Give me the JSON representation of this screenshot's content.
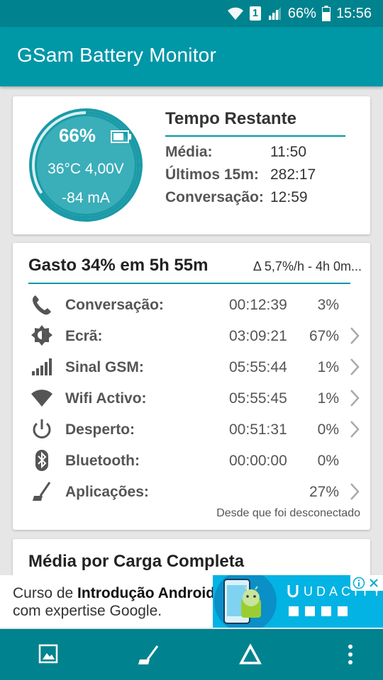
{
  "status_bar": {
    "sim_badge": "1",
    "battery_percent": "66%",
    "time": "15:56"
  },
  "app_bar": {
    "title": "GSam Battery Monitor"
  },
  "battery_card": {
    "gauge": {
      "percent": "66%",
      "level": 0.66,
      "temperature_voltage": "36°C  4,00V",
      "current": "-84 mA"
    },
    "time_remaining": {
      "title": "Tempo Restante",
      "rows": [
        {
          "label": "Média:",
          "value": "11:50"
        },
        {
          "label": "Últimos 15m:",
          "value": "282:17"
        },
        {
          "label": "Conversação:",
          "value": "12:59"
        }
      ]
    }
  },
  "usage_card": {
    "title": "Gasto 34% em 5h 55m",
    "rate": "Δ 5,7%/h - 4h 0m...",
    "rows": [
      {
        "icon": "phone-icon",
        "label": "Conversação:",
        "time": "00:12:39",
        "percent": "3%",
        "chevron": false
      },
      {
        "icon": "screen-brightness-icon",
        "label": "Ecrã:",
        "time": "03:09:21",
        "percent": "67%",
        "chevron": true
      },
      {
        "icon": "signal-icon",
        "label": "Sinal GSM:",
        "time": "05:55:44",
        "percent": "1%",
        "chevron": true
      },
      {
        "icon": "wifi-icon",
        "label": "Wifi Activo:",
        "time": "05:55:45",
        "percent": "1%",
        "chevron": true
      },
      {
        "icon": "power-icon",
        "label": "Desperto:",
        "time": "00:51:31",
        "percent": "0%",
        "chevron": true
      },
      {
        "icon": "bluetooth-icon",
        "label": "Bluetooth:",
        "time": "00:00:00",
        "percent": "0%",
        "chevron": false
      },
      {
        "icon": "apps-broom-icon",
        "label": "Aplicações:",
        "time": "",
        "percent": "27%",
        "chevron": true
      }
    ],
    "footer": "Desde que foi desconectado"
  },
  "average_card": {
    "title": "Média por Carga Completa"
  },
  "ad": {
    "line1_prefix": "Curso de ",
    "line1_bold": "Introdução Android",
    "line2": "com expertise Google.",
    "brand": "UDACITY"
  },
  "bottom_bar": {
    "items": [
      "image-icon",
      "apps-broom-icon",
      "delta-icon",
      "overflow-menu-icon"
    ]
  }
}
